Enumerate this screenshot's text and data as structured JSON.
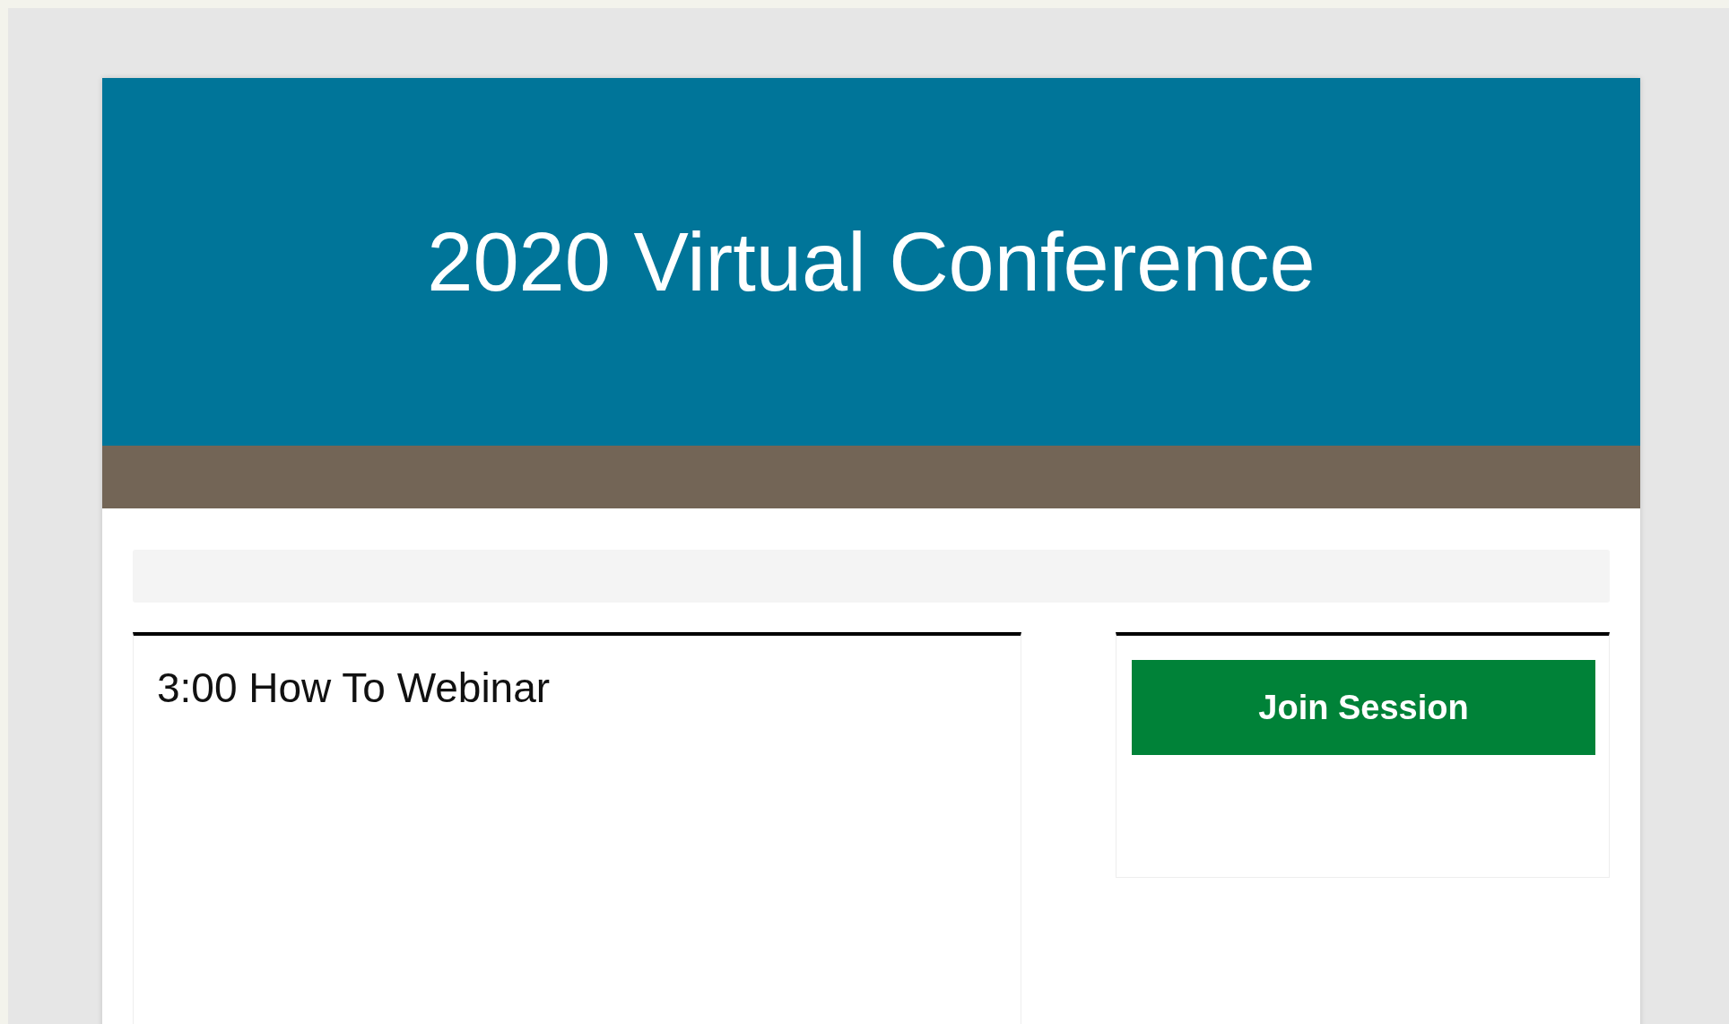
{
  "header": {
    "title": "2020 Virtual Conference"
  },
  "session": {
    "title": "3:00 How To Webinar"
  },
  "action": {
    "label": "Join Session"
  }
}
